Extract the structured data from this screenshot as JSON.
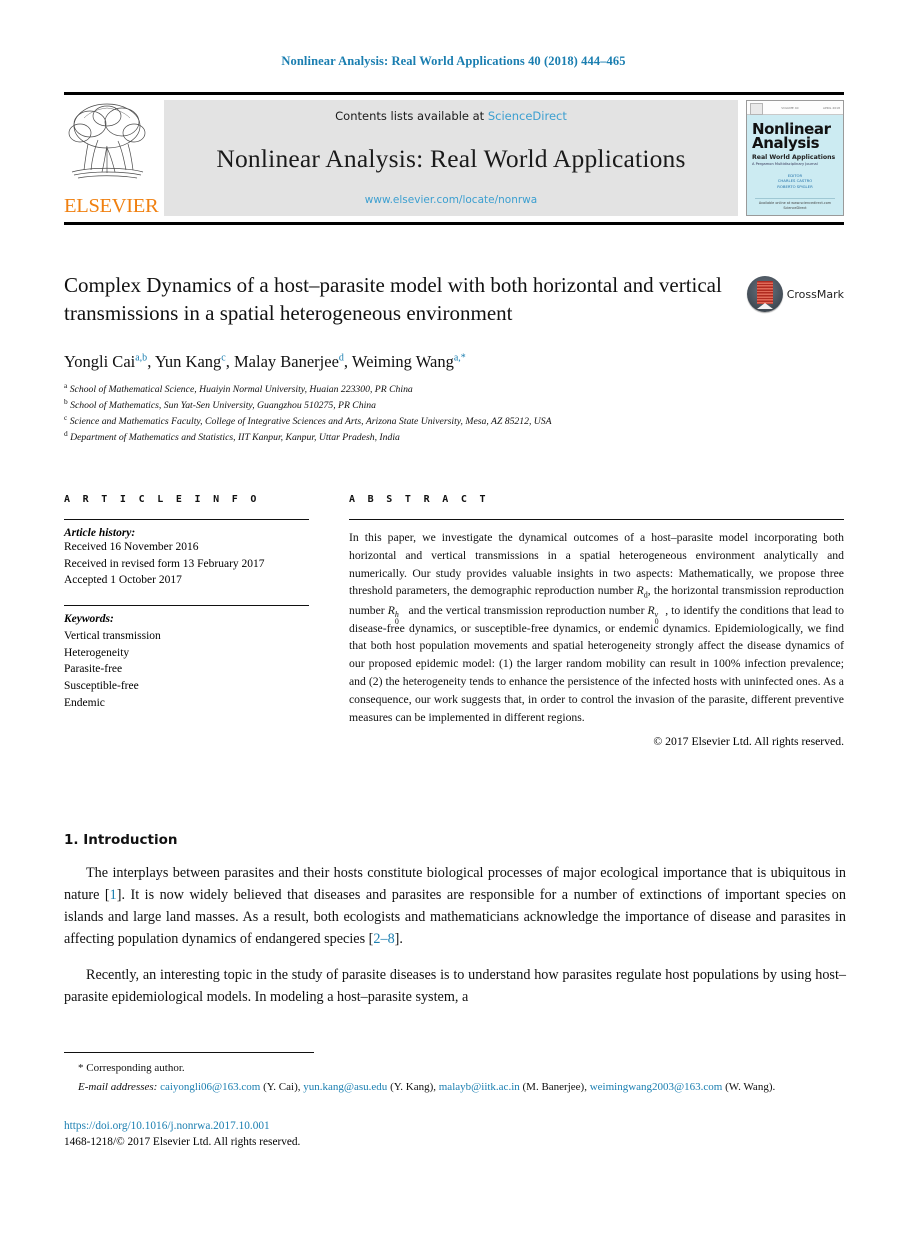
{
  "running_head": "Nonlinear Analysis: Real World Applications 40 (2018) 444–465",
  "masthead": {
    "publisher": "ELSEVIER",
    "contents_prefix": "Contents lists available at ",
    "contents_link": "ScienceDirect",
    "journal_title": "Nonlinear Analysis: Real World Applications",
    "journal_url": "www.elsevier.com/locate/nonrwa",
    "cover": {
      "title_line1": "Nonlinear",
      "title_line2": "Analysis",
      "subtitle": "Real World Applications",
      "subtitle2": "A Pergamon Multidisciplinary Journal",
      "editors_label": "EDITOR",
      "editor1": "CHARLES CASTRO",
      "editor2": "ROBERTO SPIGLER",
      "footer1": "Available online at www.sciencedirect.com",
      "footer2": "ScienceDirect",
      "top_left": "ISSN",
      "top_mid": "VOLUME 40",
      "top_right": "APRIL 2018"
    }
  },
  "article": {
    "title": "Complex Dynamics of a host–parasite model with both horizontal and vertical transmissions in a spatial heterogeneous environment",
    "crossmark_label": "CrossMark",
    "authors_html": "Yongli Cai<sup>a,b</sup>, Yun Kang<sup>c</sup>, Malay Banerjee<sup>d</sup>, Weiming Wang<sup>a,</sup><sup>*</sup>",
    "affiliations": [
      {
        "marker": "a",
        "text": "School of Mathematical Science, Huaiyin Normal University, Huaian 223300, PR China"
      },
      {
        "marker": "b",
        "text": "School of Mathematics, Sun Yat-Sen University, Guangzhou 510275, PR China"
      },
      {
        "marker": "c",
        "text": "Science and Mathematics Faculty, College of Integrative Sciences and Arts, Arizona State University, Mesa, AZ 85212, USA"
      },
      {
        "marker": "d",
        "text": "Department of Mathematics and Statistics, IIT Kanpur, Kanpur, Uttar Pradesh, India"
      }
    ]
  },
  "info": {
    "heading": "A R T I C L E   I N F O",
    "history_label": "Article history:",
    "history": [
      "Received 16 November 2016",
      "Received in revised form 13 February 2017",
      "Accepted 1 October 2017"
    ],
    "keywords_label": "Keywords:",
    "keywords": [
      "Vertical transmission",
      "Heterogeneity",
      "Parasite-free",
      "Susceptible-free",
      "Endemic"
    ]
  },
  "abstract": {
    "heading": "A B S T R A C T",
    "part1": "In this paper, we investigate the dynamical outcomes of a host–parasite model incorporating both horizontal and vertical transmissions in a spatial heterogeneous environment analytically and numerically. Our study provides valuable insights in two aspects: Mathematically, we propose three threshold parameters, the demographic reproduction number ",
    "sym_rd": "R",
    "sym_rd_sub": "d",
    "part2": ", the horizontal transmission reproduction number ",
    "sym_r0h_base": "R",
    "sym_r0h_sup": "h",
    "sym_r0h_sub": "0",
    "part3": " and the vertical transmission reproduction number ",
    "sym_r0v_base": "R",
    "sym_r0v_sup": "v",
    "sym_r0v_sub": "0",
    "part4": ", to identify the conditions that lead to disease-free dynamics, or susceptible-free dynamics, or endemic dynamics. Epidemiologically, we find that both host population movements and spatial heterogeneity strongly affect the disease dynamics of our proposed epidemic model: (1) the larger random mobility can result in 100% infection prevalence; and (2) the heterogeneity tends to enhance the persistence of the infected hosts with uninfected ones. As a consequence, our work suggests that, in order to control the invasion of the parasite, different preventive measures can be implemented in different regions.",
    "rights": "© 2017 Elsevier Ltd. All rights reserved."
  },
  "body": {
    "section_title": "1. Introduction",
    "para1_a": "The interplays between parasites and their hosts constitute biological processes of major ecological importance that is ubiquitous in nature [",
    "para1_ref1": "1",
    "para1_b": "]. It is now widely believed that diseases and parasites are responsible for a number of extinctions of important species on islands and large land masses. As a result, both ecologists and mathematicians acknowledge the importance of disease and parasites in affecting population dynamics of endangered species [",
    "para1_ref2": "2–8",
    "para1_c": "].",
    "para2": "Recently, an interesting topic in the study of parasite diseases is to understand how parasites regulate host populations by using host–parasite epidemiological models. In modeling a host–parasite system, a"
  },
  "footnotes": {
    "corresponding": "Corresponding author.",
    "star": "*",
    "email_label": "E-mail addresses:",
    "emails": [
      {
        "address": "caiyongli06@163.com",
        "name": "(Y. Cai),"
      },
      {
        "address": "yun.kang@asu.edu",
        "name": "(Y. Kang),"
      },
      {
        "address": "malayb@iitk.ac.in",
        "name": "(M. Banerjee),"
      },
      {
        "address": "weimingwang2003@163.com",
        "name": "(W. Wang)."
      }
    ],
    "doi": "https://doi.org/10.1016/j.nonrwa.2017.10.001",
    "copyright": "1468-1218/© 2017 Elsevier Ltd. All rights reserved."
  },
  "colors": {
    "link_blue": "#1a7eb0",
    "sciencedirect_blue": "#3c9fd0",
    "elsevier_orange": "#F08010",
    "cover_cyan": "#ccebf2"
  }
}
